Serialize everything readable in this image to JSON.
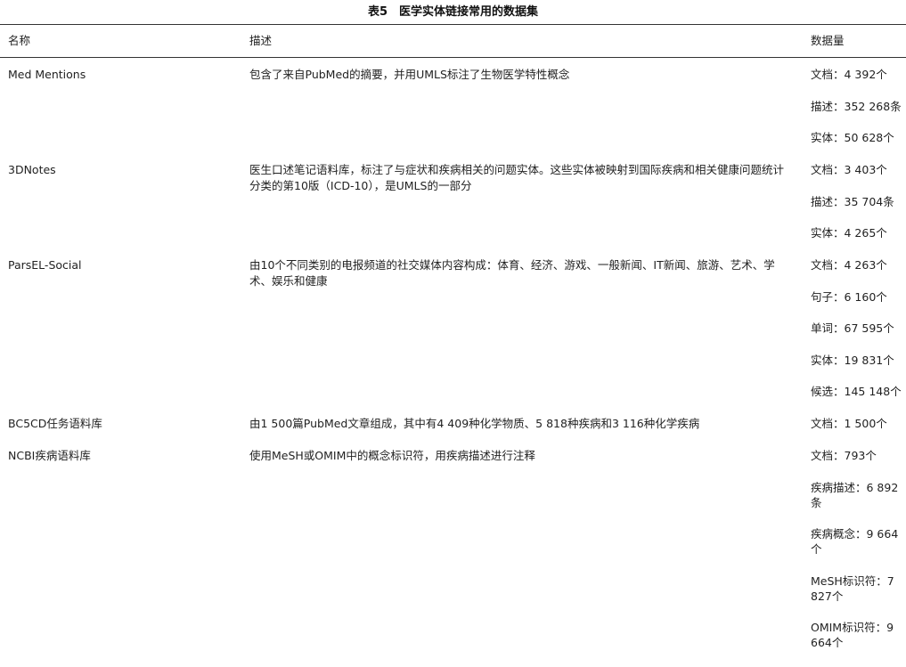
{
  "caption": "表5　医学实体链接常用的数据集",
  "headers": {
    "name": "名称",
    "desc": "描述",
    "qty": "数据量"
  },
  "rows": [
    {
      "name": "Med Mentions",
      "desc": "包含了来自PubMed的摘要，并用UMLS标注了生物医学特性概念",
      "qty": [
        "文档：4 392个",
        "描述：352 268条",
        "实体：50 628个"
      ]
    },
    {
      "name": "3DNotes",
      "desc": "医生口述笔记语料库，标注了与症状和疾病相关的问题实体。这些实体被映射到国际疾病和相关健康问题统计分类的第10版（ICD-10），是UMLS的一部分",
      "qty": [
        "文档：3 403个",
        "描述：35 704条",
        "实体：4 265个"
      ]
    },
    {
      "name": "ParsEL-Social",
      "desc": "由10个不同类别的电报频道的社交媒体内容构成：体育、经济、游戏、一般新闻、IT新闻、旅游、艺术、学术、娱乐和健康",
      "qty": [
        "文档：4 263个",
        "句子：6 160个",
        "单词：67 595个",
        "实体：19 831个",
        "候选：145 148个"
      ]
    },
    {
      "name": "BC5CD任务语料库",
      "desc": "由1 500篇PubMed文章组成，其中有4 409种化学物质、5 818种疾病和3 116种化学疾病",
      "qty": [
        "文档：1 500个"
      ]
    },
    {
      "name": "NCBI疾病语料库",
      "desc": "使用MeSH或OMIM中的概念标识符，用疾病描述进行注释",
      "qty": [
        "文档：793个",
        "疾病描述：6 892条",
        "疾病概念：9 664个",
        "MeSH标识符：7 827个",
        "OMIM标识符：9 664个"
      ]
    }
  ]
}
